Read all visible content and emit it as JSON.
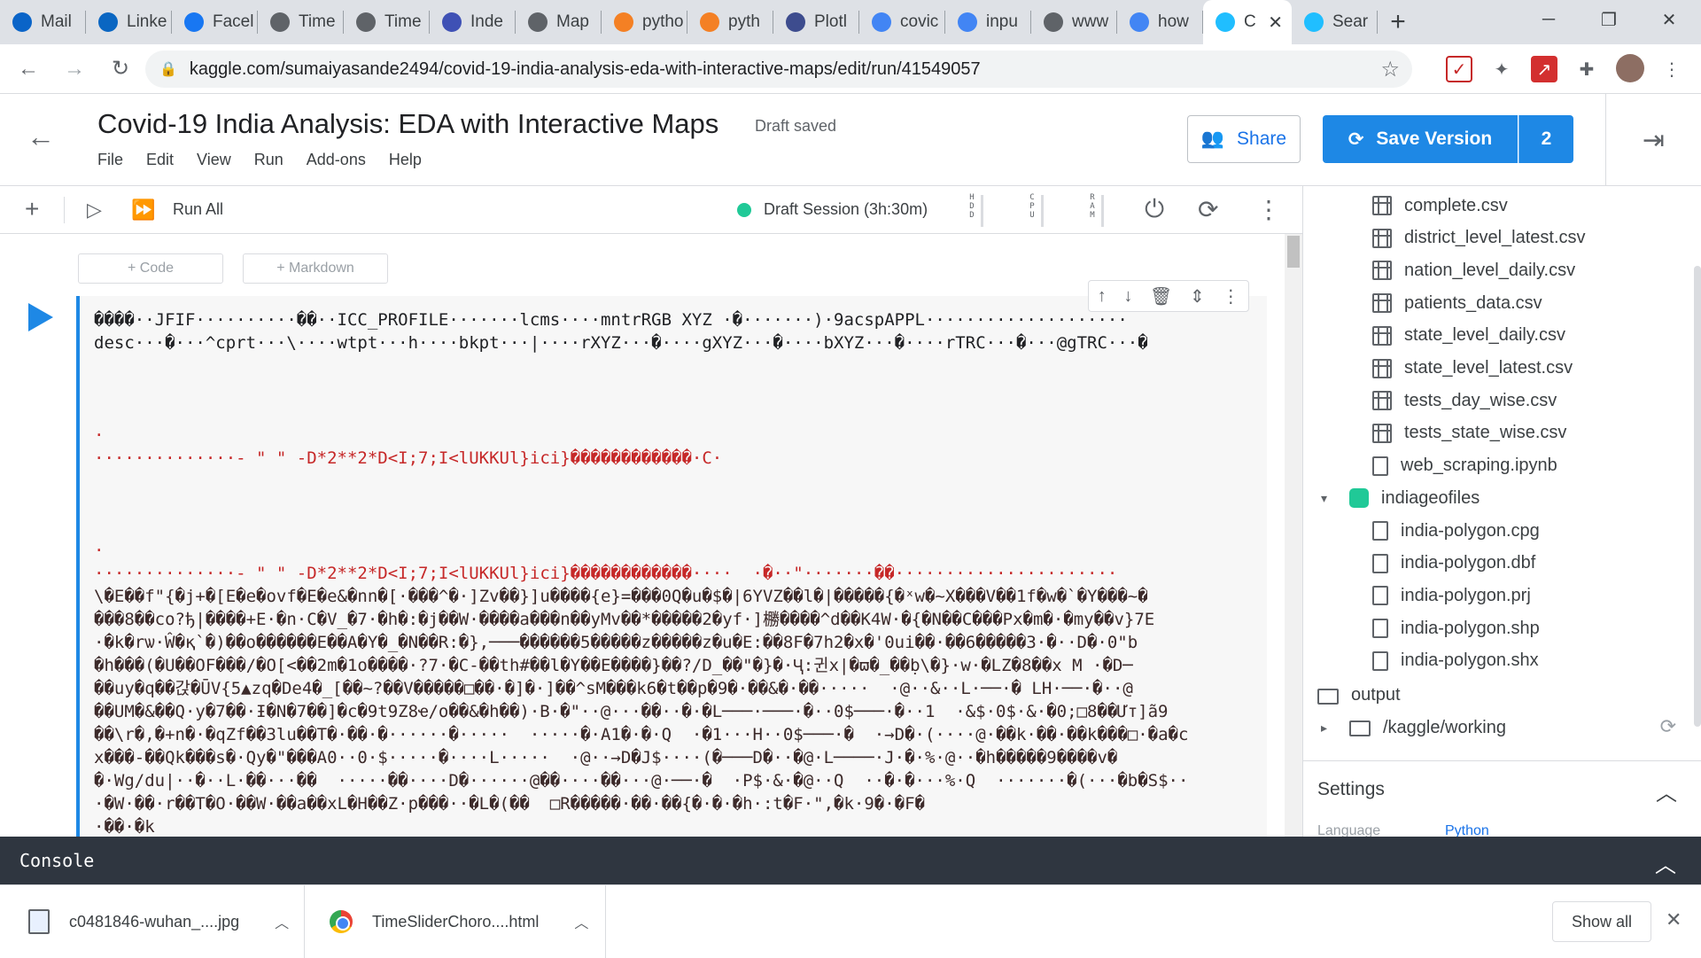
{
  "browser": {
    "tabs": [
      {
        "label": "Mail",
        "icon": "outlook-icon",
        "color": "#0a64c8"
      },
      {
        "label": "Linke",
        "icon": "linkedin-icon",
        "color": "#0a66c2"
      },
      {
        "label": "Facel",
        "icon": "facebook-icon",
        "color": "#1877f2"
      },
      {
        "label": "Time",
        "icon": "globe-icon",
        "color": "#5f6368"
      },
      {
        "label": "Time",
        "icon": "globe-icon",
        "color": "#5f6368"
      },
      {
        "label": "Inde",
        "icon": "chart-icon",
        "color": "#3f51b5"
      },
      {
        "label": "Map",
        "icon": "globe-icon",
        "color": "#5f6368"
      },
      {
        "label": "pytho",
        "icon": "stackoverflow-icon",
        "color": "#f48024"
      },
      {
        "label": "pyth",
        "icon": "stackoverflow-icon",
        "color": "#f48024"
      },
      {
        "label": "Plotl",
        "icon": "plotly-icon",
        "color": "#3d4c8e"
      },
      {
        "label": "covic",
        "icon": "google-icon",
        "color": "#4285f4"
      },
      {
        "label": "inpu",
        "icon": "google-icon",
        "color": "#4285f4"
      },
      {
        "label": "www",
        "icon": "globe-icon",
        "color": "#5f6368"
      },
      {
        "label": "how",
        "icon": "google-icon",
        "color": "#4285f4"
      },
      {
        "label": "C",
        "icon": "kaggle-icon",
        "color": "#20beff",
        "active": true
      },
      {
        "label": "Sear",
        "icon": "kaggle-icon",
        "color": "#20beff"
      }
    ],
    "url": "kaggle.com/sumaiyasande2494/covid-19-india-analysis-eda-with-interactive-maps/edit/run/41549057"
  },
  "notebook": {
    "title": "Covid-19 India Analysis: EDA with Interactive Maps",
    "status": "Draft saved",
    "menu": [
      "File",
      "Edit",
      "View",
      "Run",
      "Add-ons",
      "Help"
    ],
    "share_label": "Share",
    "save_label": "Save Version",
    "save_count": "2",
    "run_all_label": "Run All",
    "session_label": "Draft Session (3h:30m)",
    "meters": [
      "HDD",
      "CPU",
      "RAM"
    ],
    "add_code_label": "+ Code",
    "add_markdown_label": "+ Markdown"
  },
  "cell_output": [
    "����··JFIF··········��··ICC_PROFILE·······lcms····mntrRGB XYZ ·�·······)·9acspAPPL····················",
    "desc···�···^cprt···\\····wtpt···h····bkpt···|····rXYZ···�····gXYZ···�····bXYZ···�····rTRC···�···@gTRC···�",
    "",
    "",
    "",
    "·",
    "··············- \" \" -D*2**2*D<I;7;I<lUKKUl}ici}������������·C·",
    "",
    "",
    "",
    "·",
    "··············- \" \" -D*2**2*D<I;7;I<lUKKUl}ici}������������····  ·�··\"·······��······················",
    "\\�E��f\"{�j+�[E�e�ovf�E�e&�nn�[·���^�·]Zv��}]u����{e}=���0Q�u�$�|6YVZ��l�|�����{�ˣw�~X���V��1f�w�`�Y���~�",
    "���8��co?ђ|����+E·�n·C�V_�7·�h�:�j��W·����a���n��yMv��*�����2�yf·]橳����^d��K4W·�{�N��C���Px�m�·�my��v}7E",
    "·�k�rѡ·Ŵ�қ`�)��o������E��A�Y�_�N��R:�},───������5�����z�����z�u�E:��8F�7h2�x�'0ui��·��6�����3·�··D�·0\"b",
    "�h���(�U��OF���/�O[<��2m�1o����·?7·�C-��th#��l�Y��E����}��?/D_��\"�}�·Ҷ:귄x|�ϖ�_��ḅ\\�}·w·�LZ�8��x M ·�D─",
    "��uy�q��갅�ŪV{5▲zq�De4�_[��~?��V�����□��·�]�·]��^sM���k6�t��p�9�·��&�·��·····  ·@··&··L·──·� LH·──·�··@",
    "��UM�&��Q·y�7��·Ɨ�N�7��]�c�9t9Z8ҽ/o��&�h��)·B·�\"··@···��··�·�L───·───·�··0$───·�··1  ·&$·0$·&·�0;□8��Ưт]ã9",
    "��\\r�,�+n�·�qZf��3lu��T�·��·�······�·····  ·····�·A1�·�·Q  ·�1···H··0$───·�  ·→D�·(····@·��k·��·��k���□·�a�c",
    "x���-��Qk���ѕ�·Qy�\"���A0··0·$·····�····L·····  ·@··→D�J$····(�───D�··�@·L────·J·�·%·@··�h�����9����v�",
    "�·Wg/du|··�··L·��···��  ·····��····D�······@��····��···@·──·�  ·P$·&·�@··Q  ··�·�···%·Q  ·······�(···�b�S$··",
    "·�W·��·r��T�O·��W·��a��xL�H��Z·p���··�L�(��  □R�����·��·��{�·�·�h·:t�F·\",�k·9�·�F�",
    "·��·�k"
  ],
  "files": {
    "csv": [
      "complete.csv",
      "district_level_latest.csv",
      "nation_level_daily.csv",
      "patients_data.csv",
      "state_level_daily.csv",
      "state_level_latest.csv",
      "tests_day_wise.csv",
      "tests_state_wise.csv"
    ],
    "notebook": "web_scraping.ipynb",
    "dataset_folder": "indiageofiles",
    "geo_files": [
      "india-polygon.cpg",
      "india-polygon.dbf",
      "india-polygon.prj",
      "india-polygon.shp",
      "india-polygon.shx"
    ],
    "output_label": "output",
    "working_dir": "/kaggle/working",
    "settings_label": "Settings",
    "language_label": "Language",
    "language_value": "Python"
  },
  "console_label": "Console",
  "downloads": [
    {
      "name": "c0481846-wuhan_....jpg"
    },
    {
      "name": "TimeSliderChoro....html"
    }
  ],
  "show_all_label": "Show all"
}
